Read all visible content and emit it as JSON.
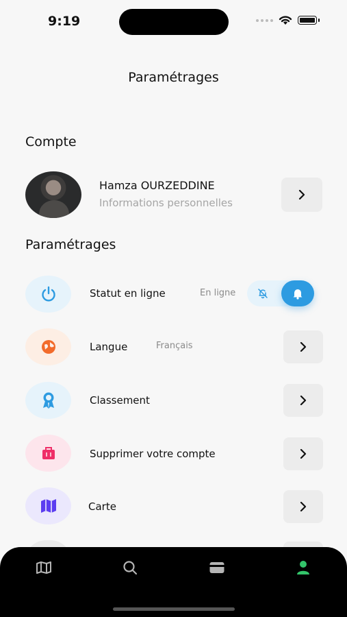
{
  "status_bar": {
    "time": "9:19"
  },
  "header": {
    "title": "Paramétrages"
  },
  "account": {
    "section_title": "Compte",
    "name": "Hamza OURZEDDINE",
    "subtitle": "Informations personnelles"
  },
  "settings": {
    "section_title": "Paramétrages",
    "items": [
      {
        "label": "Statut en ligne",
        "value": "En ligne",
        "icon": "power-icon",
        "icon_bg": "#e6f3fb",
        "icon_color": "#2d9be1"
      },
      {
        "label": "Langue",
        "value": "Français",
        "icon": "globe-icon",
        "icon_bg": "#fdeee4",
        "icon_color": "#f26b2b"
      },
      {
        "label": "Classement",
        "value": "",
        "icon": "award-icon",
        "icon_bg": "#e6f3fb",
        "icon_color": "#2d9be1"
      },
      {
        "label": "Supprimer votre compte",
        "value": "",
        "icon": "trash-icon",
        "icon_bg": "#fde5ec",
        "icon_color": "#ef2f68"
      },
      {
        "label": "Carte",
        "value": "",
        "icon": "map-icon",
        "icon_bg": "#ebe8fd",
        "icon_color": "#5b3df0"
      }
    ]
  },
  "online_toggle": {
    "state": "on"
  },
  "tabbar": {
    "tabs": [
      {
        "icon": "map-icon",
        "active": false
      },
      {
        "icon": "search-icon",
        "active": false
      },
      {
        "icon": "wallet-icon",
        "active": false
      },
      {
        "icon": "user-icon",
        "active": true
      }
    ],
    "active_color": "#33c46a",
    "inactive_color": "#b5b5b5"
  }
}
